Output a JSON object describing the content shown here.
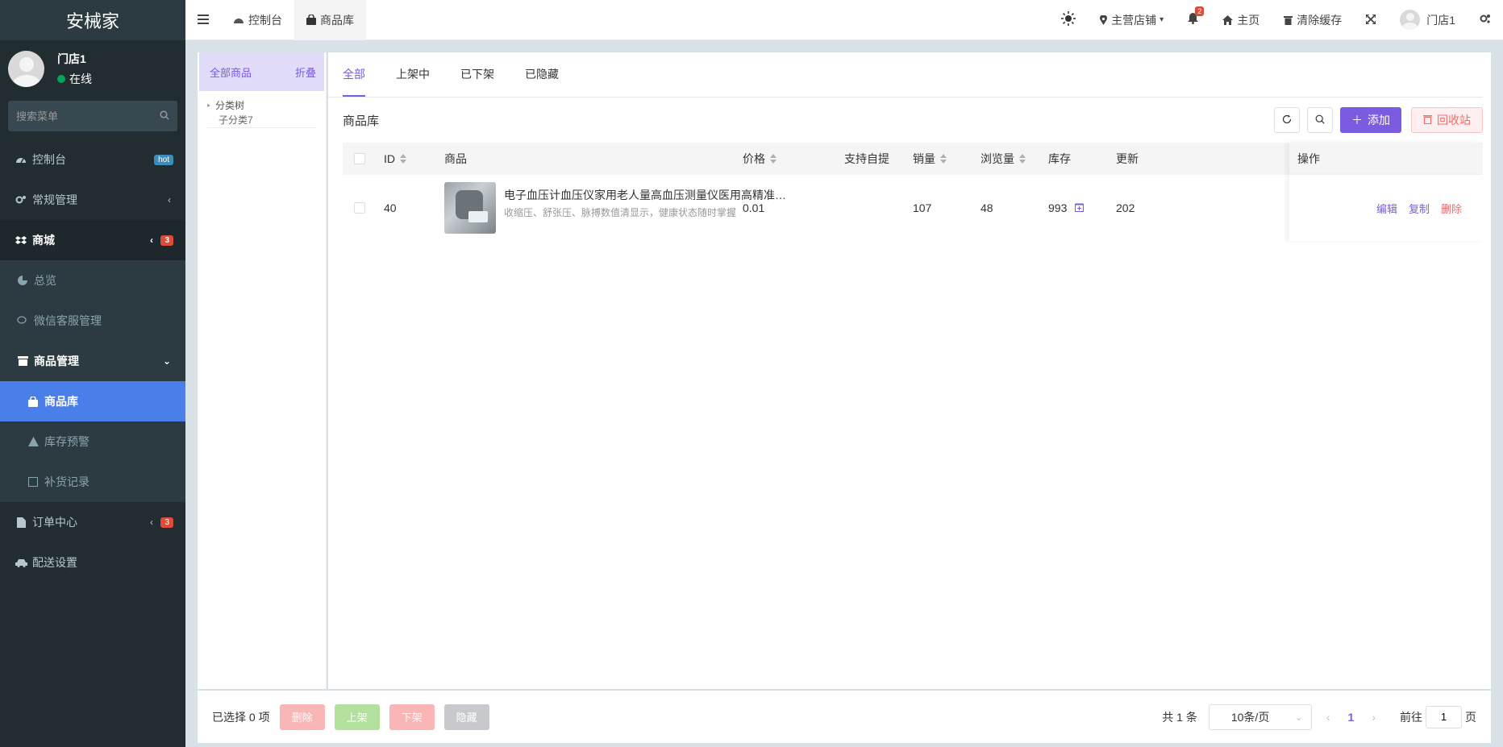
{
  "sidebar": {
    "logo": "安械家",
    "user": {
      "name": "门店1",
      "status": "在线"
    },
    "search_placeholder": "搜索菜单",
    "menu": {
      "dashboard": {
        "label": "控制台",
        "badge": "hot"
      },
      "general": {
        "label": "常规管理"
      },
      "shop": {
        "label": "商城",
        "badge": "3"
      },
      "overview": {
        "label": "总览"
      },
      "wechat": {
        "label": "微信客服管理"
      },
      "goods_mgmt": {
        "label": "商品管理"
      },
      "goods_lib": {
        "label": "商品库"
      },
      "stock_alert": {
        "label": "库存预警"
      },
      "restock": {
        "label": "补货记录"
      },
      "orders": {
        "label": "订单中心",
        "badge": "3"
      },
      "delivery": {
        "label": "配送设置"
      }
    }
  },
  "topbar": {
    "tabs": [
      {
        "label": "控制台"
      },
      {
        "label": "商品库"
      }
    ],
    "store_select": "主营店铺",
    "notif_count": "2",
    "home": "主页",
    "clear_cache": "清除缓存",
    "user": "门店1"
  },
  "category": {
    "all": "全部商品",
    "collapse": "折叠",
    "tree_root": "分类树",
    "tree_child": "子分类7"
  },
  "tabs": [
    "全部",
    "上架中",
    "已下架",
    "已隐藏"
  ],
  "table_title": "商品库",
  "buttons": {
    "add": "添加",
    "recycle": "回收站"
  },
  "columns": {
    "id": "ID",
    "product": "商品",
    "price": "价格",
    "pickup": "支持自提",
    "sales": "销量",
    "views": "浏览量",
    "stock": "库存",
    "updated": "更新",
    "ops": "操作"
  },
  "rows": [
    {
      "id": "40",
      "title": "电子血压计血压仪家用老人量高血压测量仪医用高精准全自动臂式",
      "desc": "收缩压、舒张压、脉搏数值清显示，健康状态随时掌握",
      "price": "0.01",
      "sales": "107",
      "views": "48",
      "stock": "993",
      "updated": "202",
      "ops": {
        "edit": "编辑",
        "copy": "复制",
        "delete": "删除"
      }
    }
  ],
  "bottom": {
    "selected": "已选择 0 项",
    "delete": "删除",
    "on": "上架",
    "off": "下架",
    "hide": "隐藏",
    "total": "共 1 条",
    "page_size": "10条/页",
    "current_page": "1",
    "goto_prefix": "前往",
    "goto_value": "1",
    "goto_suffix": "页"
  },
  "colors": {
    "primary": "#7b5be0",
    "sidebar_bg": "#222d32",
    "active_menu": "#4a7ee8",
    "danger": "#f56c6c"
  }
}
